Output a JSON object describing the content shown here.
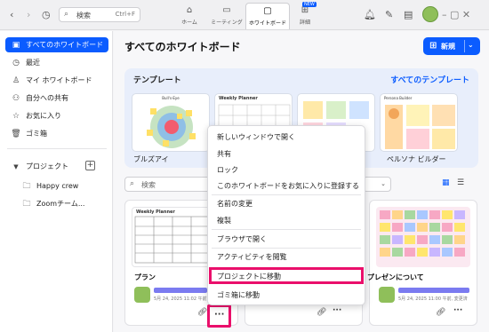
{
  "toolbar": {
    "search_placeholder": "検索",
    "search_shortcut": "Ctrl+F",
    "tabs": [
      {
        "label": "ホーム",
        "icon": "home-icon"
      },
      {
        "label": "ミーティング",
        "icon": "video-icon"
      },
      {
        "label": "ホワイトボード",
        "icon": "whiteboard-icon",
        "active": true
      },
      {
        "label": "詳細",
        "icon": "grid-icon",
        "badge": "NEW"
      }
    ]
  },
  "sidebar": {
    "items": [
      {
        "label": "すべてのホワイトボード",
        "icon": "board-icon",
        "active": true
      },
      {
        "label": "最近",
        "icon": "clock-icon"
      },
      {
        "label": "マイ ホワイトボード",
        "icon": "user-icon"
      },
      {
        "label": "自分への共有",
        "icon": "people-icon"
      },
      {
        "label": "お気に入り",
        "icon": "star-icon"
      },
      {
        "label": "ゴミ箱",
        "icon": "trash-icon"
      }
    ],
    "projects_label": "プロジェクト",
    "projects": [
      {
        "label": "Happy crew",
        "icon": "folder-icon"
      },
      {
        "label": "Zoomチーム...",
        "icon": "folder-icon"
      }
    ]
  },
  "main": {
    "title": "すべてのホワイトボード",
    "new_label": "新規",
    "templates_title": "テンプレート",
    "templates_all": "すべてのテンプレート",
    "templates": [
      {
        "label": "ブルズアイ",
        "thumb_title": "Bull's-Eye"
      },
      {
        "label": "",
        "thumb_title": "Weekly Planner"
      },
      {
        "label": "",
        "thumb_title": ""
      },
      {
        "label": "ペルソナ ビルダー",
        "thumb_title": "Persona Builder"
      }
    ],
    "filter_placeholder": "検索",
    "cards": [
      {
        "name": "プラン",
        "meta": "5月 24, 2025 11:02 午前, 変更済み",
        "thumb_title": "Weekly Planner"
      },
      {
        "name": "",
        "meta": "",
        "thumb_title": ""
      },
      {
        "name": "プレゼンについて",
        "meta": "5月 24, 2025 11:00 午前, 変更済",
        "thumb_title": ""
      }
    ]
  },
  "menu": {
    "items": [
      "新しいウィンドウで開く",
      "共有",
      "ロック",
      "このホワイトボードをお気に入りに登録する",
      "名前の変更",
      "複製",
      "ブラウザで開く",
      "アクティビティを閲覧",
      "プロジェクトに移動",
      "ゴミ箱に移動"
    ],
    "highlighted": "プロジェクトに移動"
  },
  "colors": {
    "accent": "#0b5cff",
    "highlight": "#ea0f6b"
  }
}
